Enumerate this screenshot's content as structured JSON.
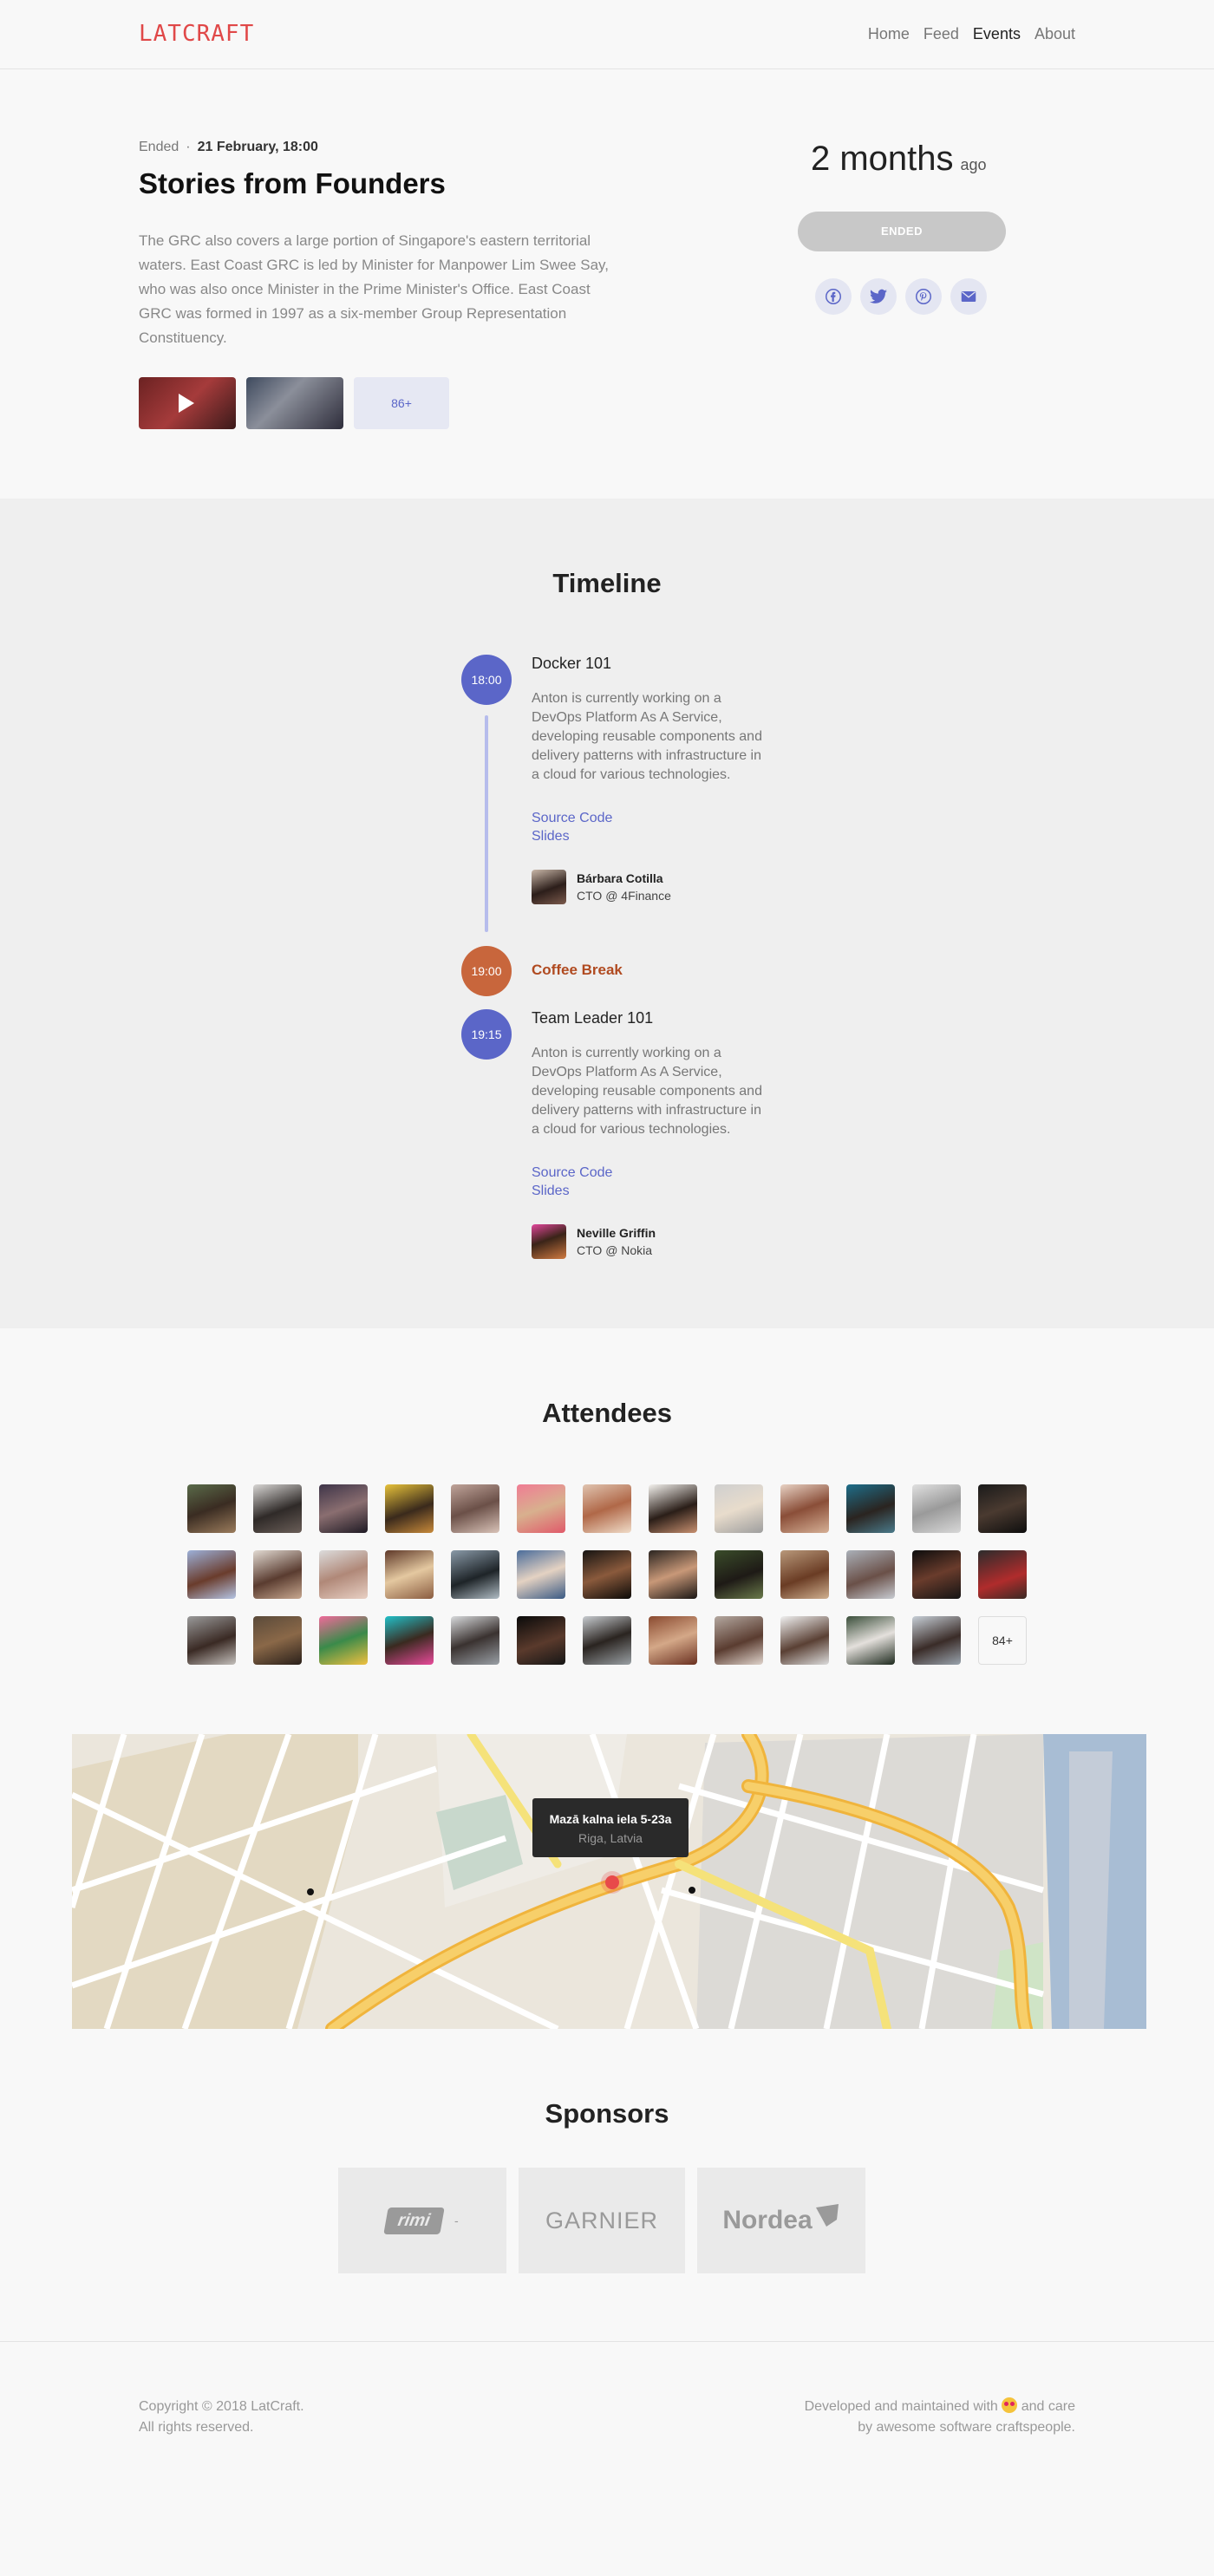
{
  "header": {
    "logo": "LATCRAFT",
    "nav": [
      "Home",
      "Feed",
      "Events",
      "About"
    ],
    "active_nav": "Events"
  },
  "event": {
    "status": "Ended",
    "date": "21 February, 18:00",
    "title": "Stories from Founders",
    "description": "The GRC also covers a large portion of Singapore's eastern territorial waters. East Coast GRC is led by Minister for Manpower Lim Swee Say, who was also once Minister in the Prime Minister's Office. East Coast GRC was formed in 1997 as a six-member Group Representation Constituency.",
    "media_more": "86+",
    "ago_value": "2 months",
    "ago_suffix": "ago",
    "status_button": "ENDED",
    "share_icons": [
      "facebook-icon",
      "twitter-icon",
      "pinterest-icon",
      "email-icon"
    ]
  },
  "timeline": {
    "title": "Timeline",
    "items": [
      {
        "time": "18:00",
        "title": "Docker 101",
        "description": "Anton is currently working on a DevOps Platform As A Service, developing reusable components and delivery patterns with infrastructure in a cloud for various technologies.",
        "links": [
          "Source Code",
          "Slides"
        ],
        "speaker": {
          "name": "Bárbara Cotilla",
          "role": "CTO @ 4Finance"
        }
      },
      {
        "time": "19:00",
        "title": "Coffee Break"
      },
      {
        "time": "19:15",
        "title": "Team Leader 101",
        "description": "Anton is currently working on a DevOps Platform As A Service, developing reusable components and delivery patterns with infrastructure in a cloud for various technologies.",
        "links": [
          "Source Code",
          "Slides"
        ],
        "speaker": {
          "name": "Neville Griffin",
          "role": "CTO @ Nokia"
        }
      }
    ]
  },
  "attendees": {
    "title": "Attendees",
    "more": "84+"
  },
  "map": {
    "address": "Mazā kalna iela 5-23a",
    "city": "Riga, Latvia"
  },
  "sponsors": {
    "title": "Sponsors",
    "items": [
      "rimi",
      "GARNIER",
      "Nordea"
    ]
  },
  "footer": {
    "copyright_line1": "Copyright © 2018 LatCraft.",
    "copyright_line2": "All rights reserved.",
    "dev_line1_a": "Developed and maintained with",
    "dev_line1_b": "and care",
    "dev_line2": "by awesome software craftspeople."
  },
  "colors": {
    "accent": "#5b66c8",
    "logo": "#e04848",
    "break": "#c8663c"
  }
}
